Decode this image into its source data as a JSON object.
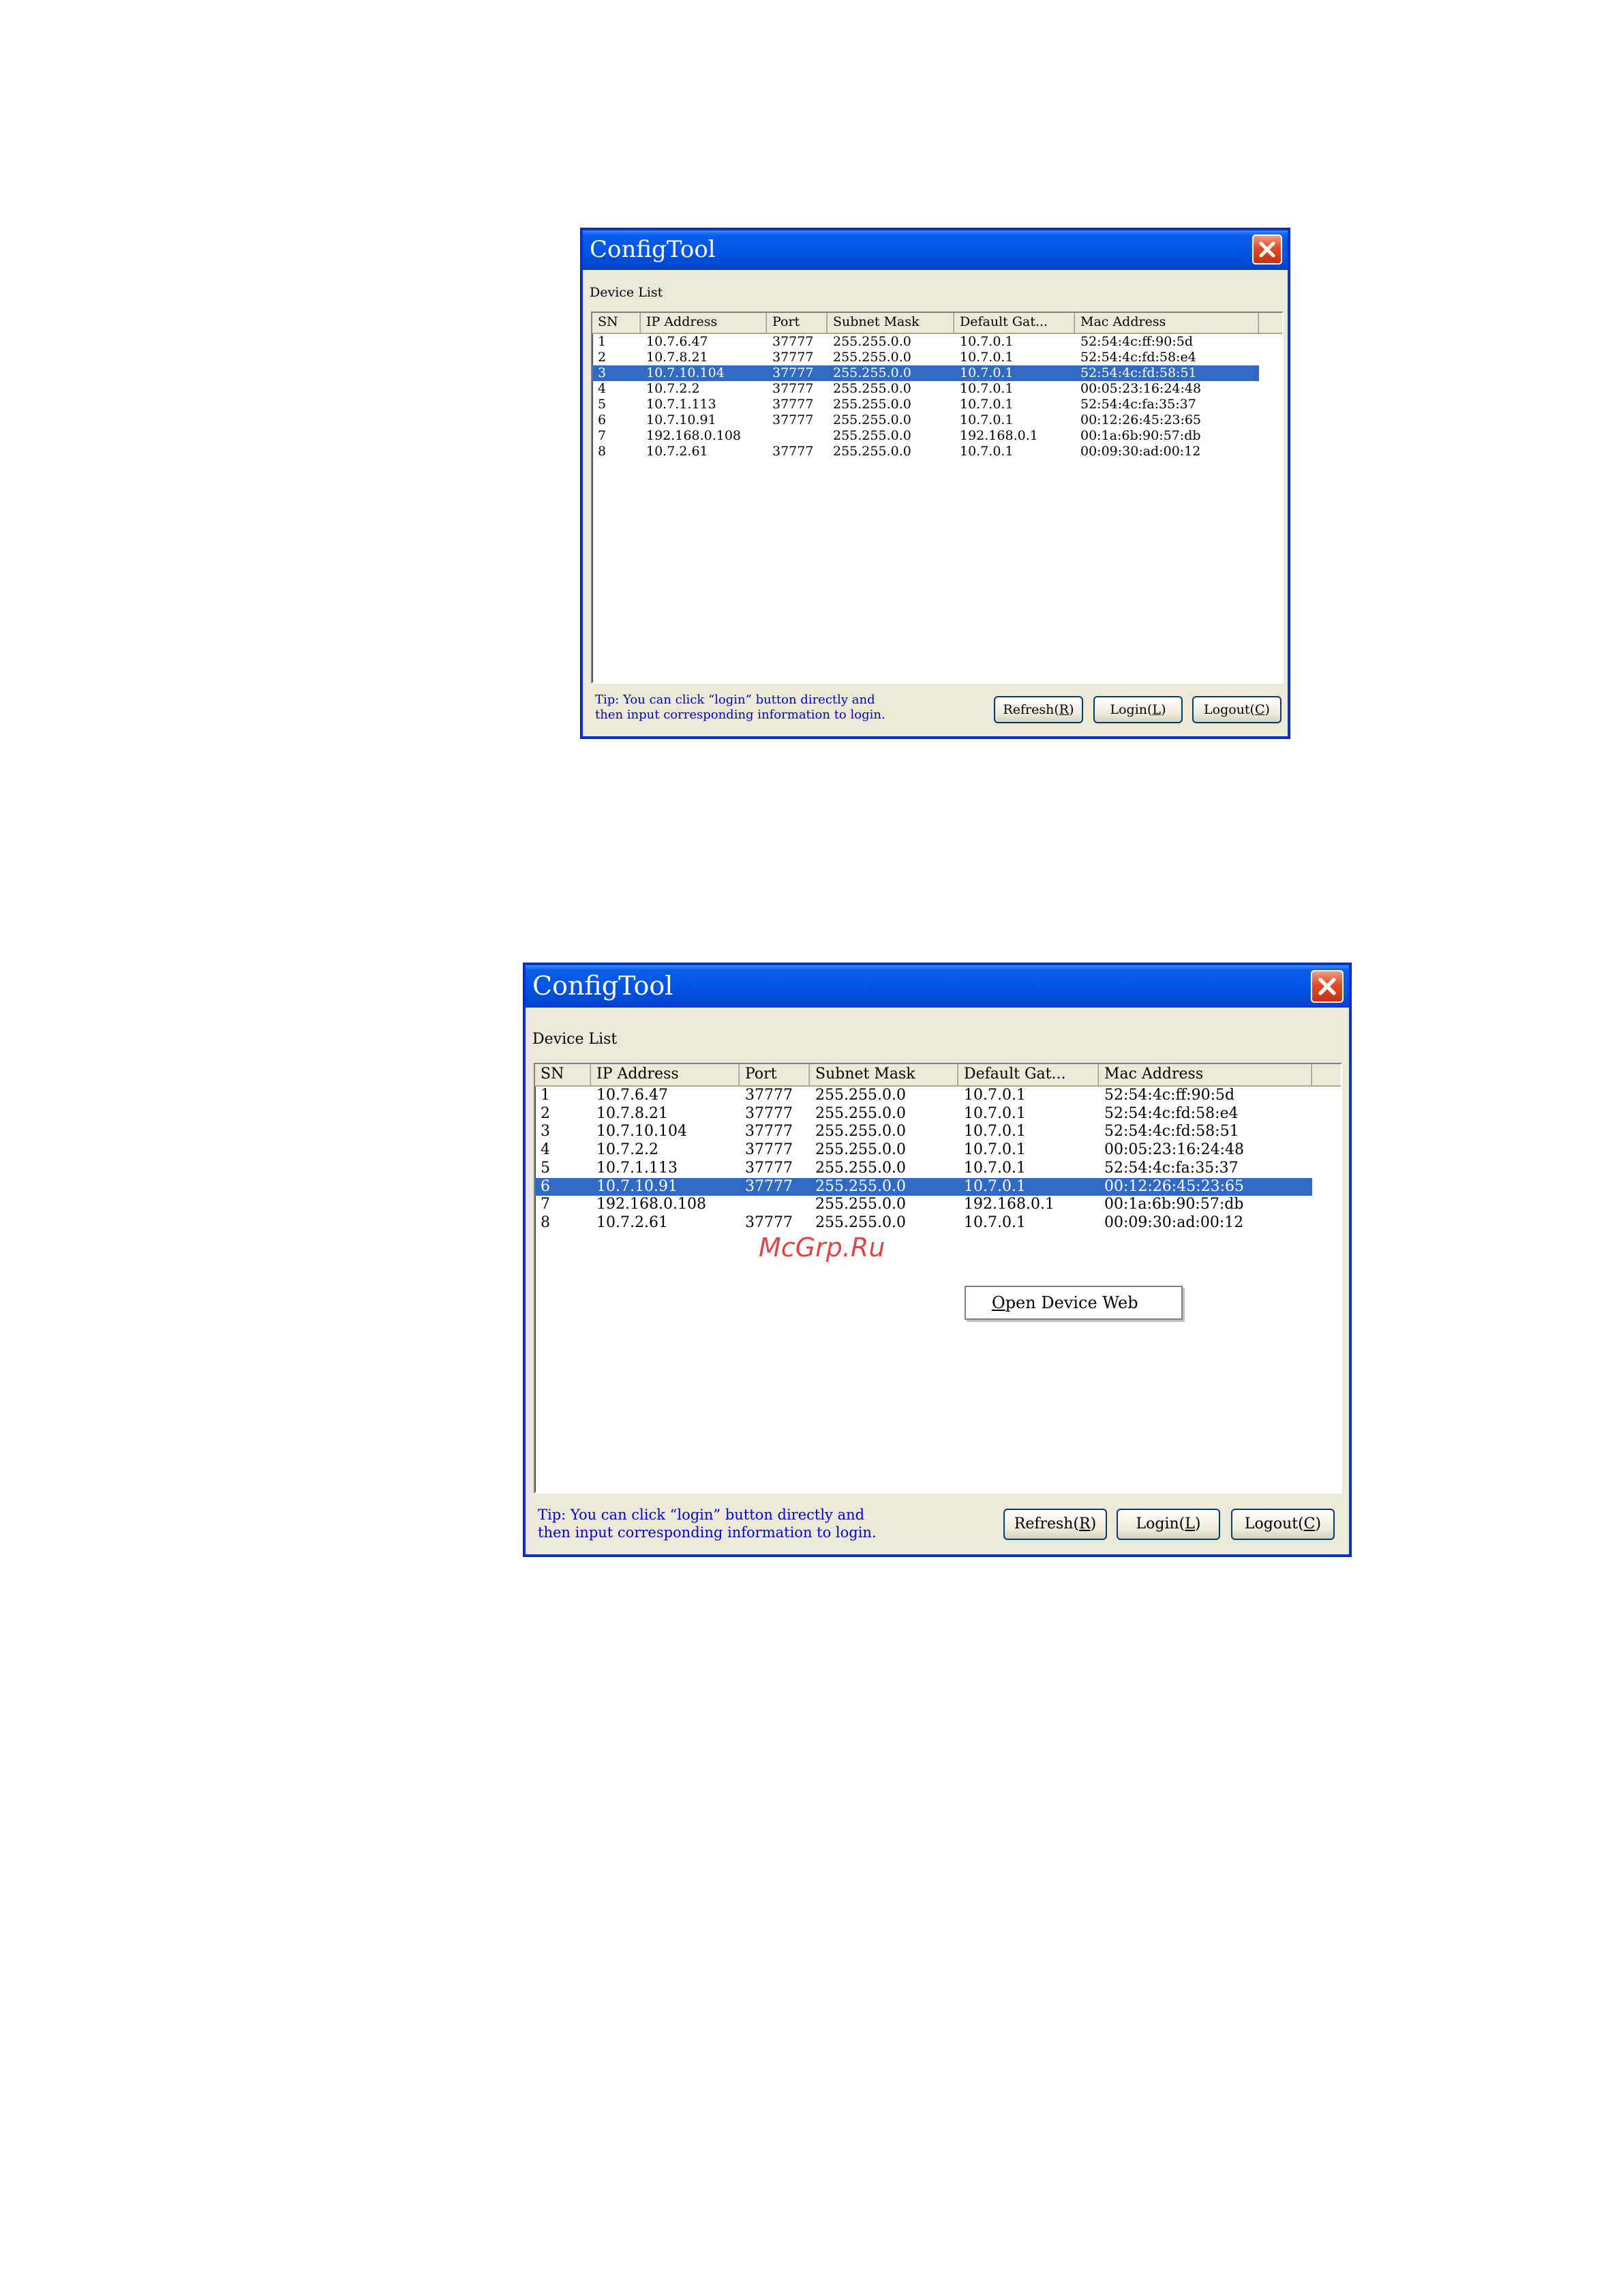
{
  "window1": {
    "title": "ConfigTool",
    "device_list_label": "Device List",
    "columns": [
      "SN",
      "IP Address",
      "Port",
      "Subnet Mask",
      "Default Gat...",
      "Mac Address"
    ],
    "rows": [
      [
        "1",
        "10.7.6.47",
        "37777",
        "255.255.0.0",
        "10.7.0.1",
        "52:54:4c:ff:90:5d"
      ],
      [
        "2",
        "10.7.8.21",
        "37777",
        "255.255.0.0",
        "10.7.0.1",
        "52:54:4c:fd:58:e4"
      ],
      [
        "3",
        "10.7.10.104",
        "37777",
        "255.255.0.0",
        "10.7.0.1",
        "52:54:4c:fd:58:51"
      ],
      [
        "4",
        "10.7.2.2",
        "37777",
        "255.255.0.0",
        "10.7.0.1",
        "00:05:23:16:24:48"
      ],
      [
        "5",
        "10.7.1.113",
        "37777",
        "255.255.0.0",
        "10.7.0.1",
        "52:54:4c:fa:35:37"
      ],
      [
        "6",
        "10.7.10.91",
        "37777",
        "255.255.0.0",
        "10.7.0.1",
        "00:12:26:45:23:65"
      ],
      [
        "7",
        "192.168.0.108",
        "",
        "255.255.0.0",
        "192.168.0.1",
        "00:1a:6b:90:57:db"
      ],
      [
        "8",
        "10.7.2.61",
        "37777",
        "255.255.0.0",
        "10.7.0.1",
        "00:09:30:ad:00:12"
      ]
    ],
    "selected_row": 3,
    "tip_line1": "Tip: You can click “login” button directly and",
    "tip_line2": "then input corresponding information to login.",
    "buttons": {
      "refresh": {
        "label": "Refresh(",
        "key": "R",
        "suffix": ")"
      },
      "login": {
        "label": "Login(",
        "key": "L",
        "suffix": ")"
      },
      "logout": {
        "label": "Logout(",
        "key": "C",
        "suffix": ")"
      }
    }
  },
  "window2": {
    "title": "ConfigTool",
    "device_list_label": "Device List",
    "columns": [
      "SN",
      "IP Address",
      "Port",
      "Subnet Mask",
      "Default Gat...",
      "Mac Address"
    ],
    "rows": [
      [
        "1",
        "10.7.6.47",
        "37777",
        "255.255.0.0",
        "10.7.0.1",
        "52:54:4c:ff:90:5d"
      ],
      [
        "2",
        "10.7.8.21",
        "37777",
        "255.255.0.0",
        "10.7.0.1",
        "52:54:4c:fd:58:e4"
      ],
      [
        "3",
        "10.7.10.104",
        "37777",
        "255.255.0.0",
        "10.7.0.1",
        "52:54:4c:fd:58:51"
      ],
      [
        "4",
        "10.7.2.2",
        "37777",
        "255.255.0.0",
        "10.7.0.1",
        "00:05:23:16:24:48"
      ],
      [
        "5",
        "10.7.1.113",
        "37777",
        "255.255.0.0",
        "10.7.0.1",
        "52:54:4c:fa:35:37"
      ],
      [
        "6",
        "10.7.10.91",
        "37777",
        "255.255.0.0",
        "10.7.0.1",
        "00:12:26:45:23:65"
      ],
      [
        "7",
        "192.168.0.108",
        "",
        "255.255.0.0",
        "192.168.0.1",
        "00:1a:6b:90:57:db"
      ],
      [
        "8",
        "10.7.2.61",
        "37777",
        "255.255.0.0",
        "10.7.0.1",
        "00:09:30:ad:00:12"
      ]
    ],
    "selected_row": 6,
    "context_menu": {
      "key": "O",
      "label_rest": "pen Device Web"
    },
    "watermark": "McGrp.Ru",
    "tip_line1": "Tip: You can click “login” button directly and",
    "tip_line2": "then input corresponding information to login.",
    "buttons": {
      "refresh": {
        "label": "Refresh(",
        "key": "R",
        "suffix": ")"
      },
      "login": {
        "label": "Login(",
        "key": "L",
        "suffix": ")"
      },
      "logout": {
        "label": "Logout(",
        "key": "C",
        "suffix": ")"
      }
    },
    "colors": {
      "selection": "#316ac5",
      "tip_text": "#0000cc",
      "watermark": "#d42a2a"
    }
  }
}
